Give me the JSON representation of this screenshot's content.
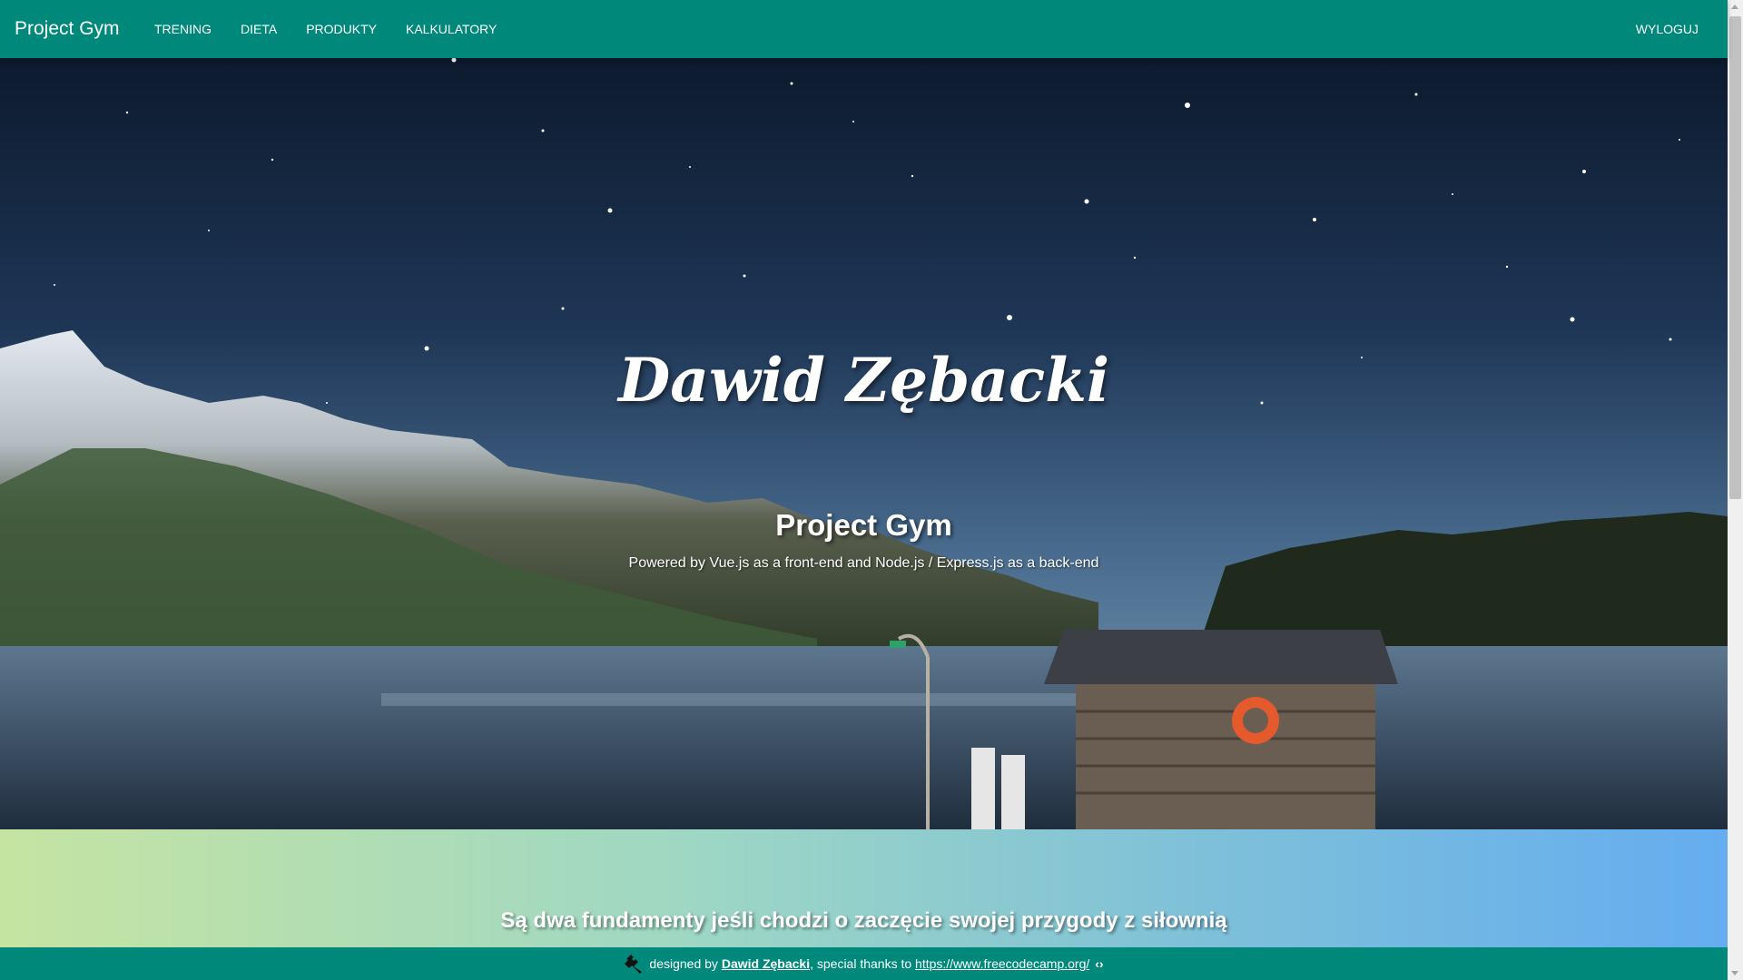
{
  "navbar": {
    "brand": "Project Gym",
    "links": [
      {
        "label": "TRENING"
      },
      {
        "label": "DIETA"
      },
      {
        "label": "PRODUKTY"
      },
      {
        "label": "KALKULATORY"
      }
    ],
    "logout": "WYLOGUJ"
  },
  "hero": {
    "title": "Dawid Zębacki",
    "subtitle": "Project Gym",
    "powered": "Powered by Vue.js as a front-end and Node.js / Express.js as a back-end"
  },
  "fundamentals": {
    "text": "Są dwa fundamenty jeśli chodzi o zaczęcie swojej przygody z siłownią"
  },
  "footer": {
    "designed_by": "designed by",
    "author": "Dawid Zębacki",
    "thanks": ", special thanks to",
    "link": "https://www.freecodecamp.org/",
    "icons": [
      "wrench-icon",
      "code-icon"
    ]
  },
  "colors": {
    "primary": "#00897b",
    "gradient_start": "#c5e4a2",
    "gradient_end": "#64adf0"
  }
}
